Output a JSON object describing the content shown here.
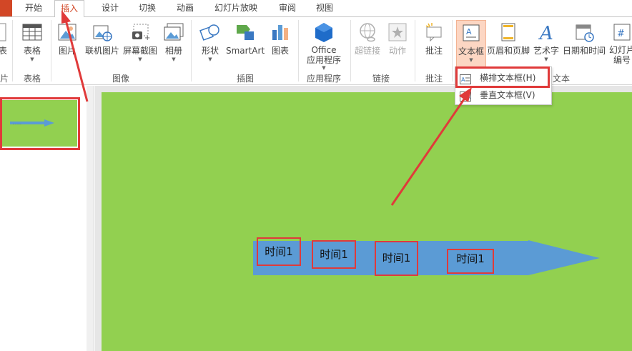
{
  "tabs": [
    "开始",
    "插入",
    "设计",
    "切换",
    "动画",
    "幻灯片放映",
    "审阅",
    "视图"
  ],
  "active_tab": "插入",
  "ribbon": {
    "partial_left": {
      "label": "表",
      "group": "片"
    },
    "table": {
      "label": "表格",
      "group": "表格"
    },
    "images": {
      "picture": "图片",
      "online_picture": "联机图片",
      "screenshot": "屏幕截图",
      "album": "相册",
      "group": "图像"
    },
    "illustrations": {
      "shapes": "形状",
      "smartart": "SmartArt",
      "chart": "图表",
      "group": "插图"
    },
    "apps": {
      "line1": "Office",
      "line2": "应用程序",
      "group": "应用程序"
    },
    "links": {
      "hyperlink": "超链接",
      "action": "动作",
      "group": "链接"
    },
    "comments": {
      "comment": "批注",
      "group": "批注"
    },
    "text": {
      "textbox": "文本框",
      "header_footer": "页眉和页脚",
      "wordart": "艺术字",
      "datetime": "日期和时间",
      "slide_number_l1": "幻灯片",
      "slide_number_l2": "编号",
      "group": "文本"
    }
  },
  "dropdown": {
    "items": [
      "横排文本框(H)",
      "垂直文本框(V)"
    ]
  },
  "slide": {
    "background_color": "#92d050",
    "arrow_color": "#5b9bd5",
    "labels": [
      "时间1",
      "时间1",
      "时间1",
      "时间1"
    ]
  },
  "colors": {
    "accent": "#d24726",
    "highlight": "#e03a3a"
  }
}
